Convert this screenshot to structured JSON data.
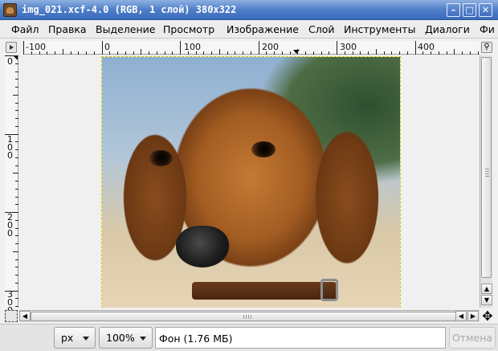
{
  "window": {
    "title": "img_021.xcf-4.0 (RGB, 1 слой) 380x322",
    "minimize_glyph": "–",
    "maximize_glyph": "□",
    "close_glyph": "✕"
  },
  "menubar": {
    "items": [
      {
        "label": "Файл"
      },
      {
        "label": "Правка"
      },
      {
        "label": "Выделение"
      },
      {
        "label": "Просмотр"
      },
      {
        "label": "Изображение"
      },
      {
        "label": "Слой"
      },
      {
        "label": "Инструменты"
      },
      {
        "label": "Диалоги"
      },
      {
        "label": "Фи"
      }
    ]
  },
  "rulers": {
    "horizontal_labels": [
      "-100",
      "0",
      "100",
      "200",
      "300",
      "400"
    ],
    "vertical_labels": [
      "0",
      "100",
      "200",
      "300"
    ]
  },
  "icons": {
    "menu_button": "triangle-right-icon",
    "zoom_toggle": "magnifier-icon",
    "quick_mask": "dashed-square-icon",
    "navigate": "navigate-cross-icon"
  },
  "scrollbars": {
    "up": "▲",
    "down": "▼",
    "left": "◀",
    "right": "▶"
  },
  "statusbar": {
    "unit": "px",
    "zoom": "100%",
    "status_text": "Фон (1.76 МБ)",
    "cancel_label": "Отмена"
  }
}
